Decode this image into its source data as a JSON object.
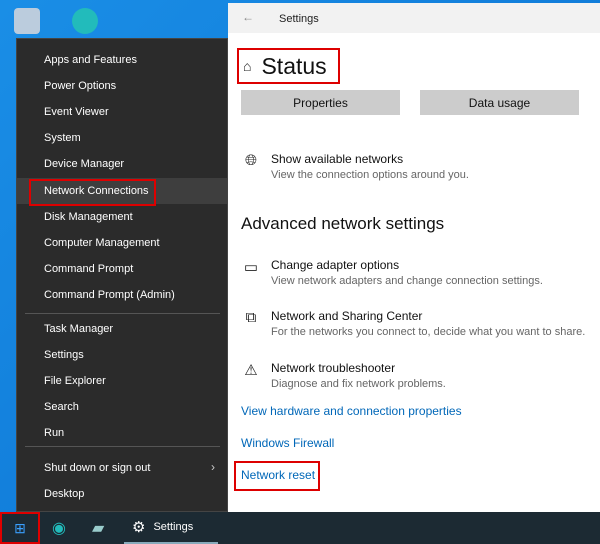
{
  "settings": {
    "window_title": "Settings",
    "page_title": "Status",
    "buttons": [
      "Properties",
      "Data usage"
    ],
    "show_networks": {
      "title": "Show available networks",
      "desc": "View the connection options around you."
    },
    "advanced_heading": "Advanced network settings",
    "items": [
      {
        "title": "Change adapter options",
        "desc": "View network adapters and change connection settings.",
        "icon": "adapter-icon"
      },
      {
        "title": "Network and Sharing Center",
        "desc": "For the networks you connect to, decide what you want to share.",
        "icon": "sharing-icon"
      },
      {
        "title": "Network troubleshooter",
        "desc": "Diagnose and fix network problems.",
        "icon": "warning-icon"
      }
    ],
    "links": [
      "View hardware and connection properties",
      "Windows Firewall",
      "Network reset"
    ]
  },
  "menu": {
    "items": [
      "Apps and Features",
      "Power Options",
      "Event Viewer",
      "System",
      "Device Manager",
      "Network Connections",
      "Disk Management",
      "Computer Management",
      "Command Prompt",
      "Command Prompt (Admin)",
      "Task Manager",
      "Settings",
      "File Explorer",
      "Search",
      "Run",
      "Shut down or sign out",
      "Desktop"
    ],
    "selected": "Network Connections"
  },
  "taskbar": {
    "settings_label": "Settings"
  },
  "colors": {
    "highlight": "#dd0000",
    "link": "#0067b8"
  }
}
